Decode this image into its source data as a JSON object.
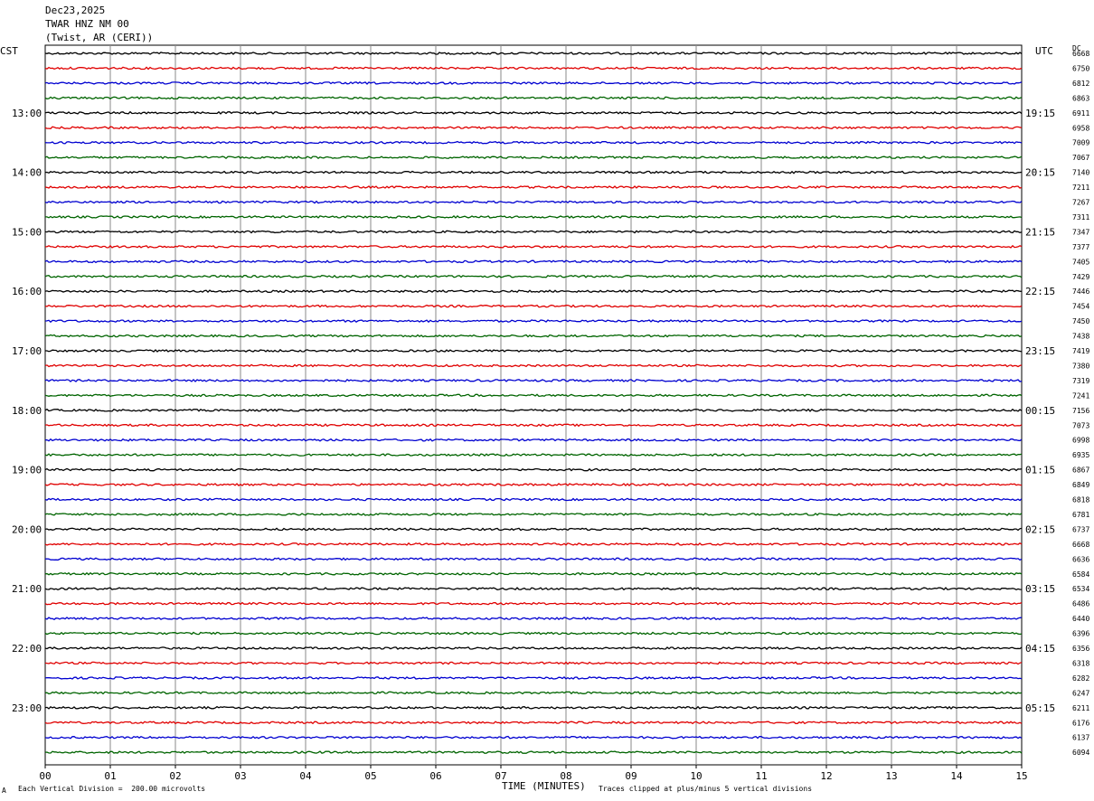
{
  "header": {
    "date": "Dec23,2025",
    "station": "TWAR HNZ NM 00",
    "location": "(Twist, AR (CERI))"
  },
  "left_axis_label": "CST",
  "right_axis_label": "UTC",
  "dc_label": "DC",
  "x_axis_title": "TIME (MINUTES)",
  "footer_left": "Each Vertical Division =  200.00 microvolts",
  "footer_right": "Traces clipped at plus/minus 5 vertical divisions",
  "footer_corner": "A",
  "chart_data": {
    "type": "line",
    "title": "TWAR HNZ NM 00",
    "xlabel": "TIME (MINUTES)",
    "ylabel": "",
    "xlim": [
      0,
      15
    ],
    "x_ticks": [
      "00",
      "01",
      "02",
      "03",
      "04",
      "05",
      "06",
      "07",
      "08",
      "09",
      "10",
      "11",
      "12",
      "13",
      "14",
      "15"
    ],
    "left_time_labels": [
      "13:00",
      "14:00",
      "15:00",
      "16:00",
      "17:00",
      "18:00",
      "19:00",
      "20:00",
      "21:00",
      "22:00",
      "23:00"
    ],
    "right_time_labels": [
      "19:15",
      "20:15",
      "21:15",
      "22:15",
      "23:15",
      "00:15",
      "01:15",
      "02:15",
      "03:15",
      "04:15",
      "05:15"
    ],
    "trace_colors": [
      "#000000",
      "#e00000",
      "#0000d0",
      "#006400"
    ],
    "dc_offsets": [
      6668,
      6750,
      6812,
      6863,
      6911,
      6958,
      7009,
      7067,
      7140,
      7211,
      7267,
      7311,
      7347,
      7377,
      7405,
      7429,
      7446,
      7454,
      7450,
      7438,
      7419,
      7380,
      7319,
      7241,
      7156,
      7073,
      6998,
      6935,
      6867,
      6849,
      6818,
      6781,
      6737,
      6668,
      6636,
      6584,
      6534,
      6486,
      6440,
      6396,
      6356,
      6318,
      6282,
      6247,
      6211,
      6176,
      6137,
      6094
    ],
    "trace_count": 48,
    "grid": true
  }
}
